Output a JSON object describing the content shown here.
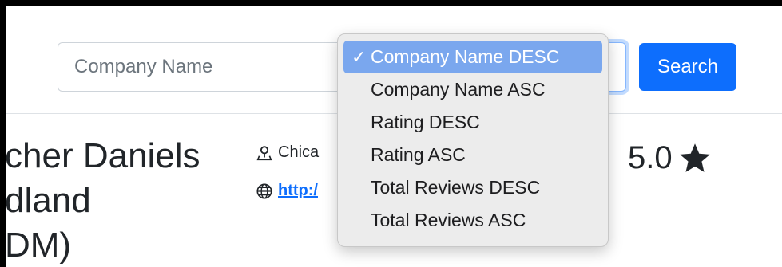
{
  "search": {
    "placeholder": "Company Name",
    "button_label": "Search"
  },
  "sort_dropdown": {
    "options": [
      {
        "label": "Company Name DESC",
        "selected": true
      },
      {
        "label": "Company Name ASC",
        "selected": false
      },
      {
        "label": "Rating DESC",
        "selected": false
      },
      {
        "label": "Rating ASC",
        "selected": false
      },
      {
        "label": "Total Reviews DESC",
        "selected": false
      },
      {
        "label": "Total Reviews ASC",
        "selected": false
      }
    ],
    "check_mark": "✓"
  },
  "company": {
    "name": "cher Daniels\ndland\nDM)",
    "location": "Chica",
    "website": "http:/",
    "rating": "5.0"
  },
  "colors": {
    "primary": "#0d6efd",
    "selected_item": "#7aa7ee",
    "dropdown_bg": "#ececec"
  }
}
